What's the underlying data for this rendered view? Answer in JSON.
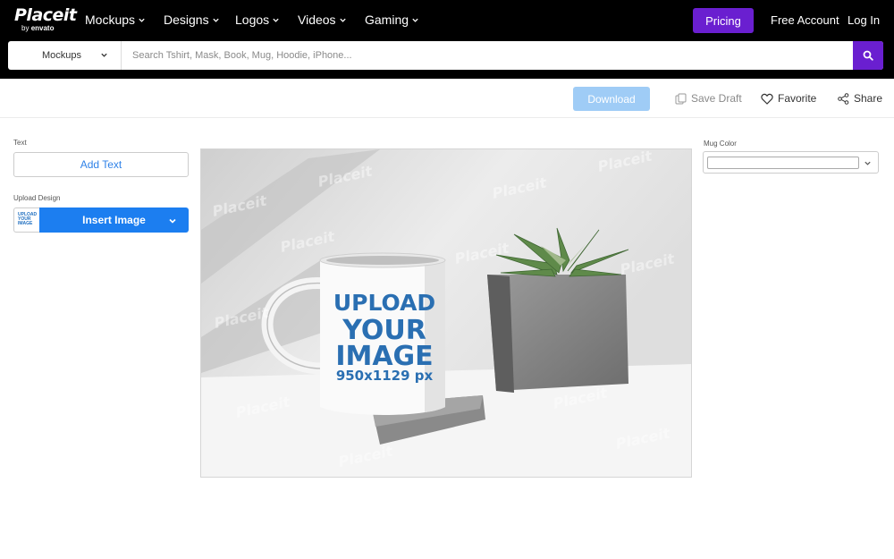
{
  "brand": {
    "name": "Placeit",
    "by": "by",
    "parent": "envato"
  },
  "nav": {
    "items": [
      {
        "label": "Mockups"
      },
      {
        "label": "Designs"
      },
      {
        "label": "Logos"
      },
      {
        "label": "Videos"
      },
      {
        "label": "Gaming"
      }
    ],
    "pricing": "Pricing",
    "free_account": "Free Account",
    "login": "Log In"
  },
  "search": {
    "category": "Mockups",
    "placeholder": "Search Tshirt, Mask, Book, Mug, Hoodie, iPhone...",
    "value": ""
  },
  "toolbar": {
    "download": "Download",
    "save_draft": "Save Draft",
    "favorite": "Favorite",
    "share": "Share"
  },
  "left_panel": {
    "text_label": "Text",
    "add_text": "Add Text",
    "upload_label": "Upload Design",
    "thumb_lines": [
      "UPLOAD",
      "YOUR",
      "IMAGE"
    ],
    "insert_image": "Insert Image"
  },
  "canvas": {
    "watermark": "Placeit",
    "mug_text": [
      "UPLOAD",
      "YOUR",
      "IMAGE"
    ],
    "mug_size": "950x1129 px"
  },
  "right_panel": {
    "mug_color_label": "Mug Color",
    "mug_color_value": "#ffffff"
  },
  "colors": {
    "accent_purple": "#6a1fd0",
    "primary_blue": "#1c7ef0",
    "download_disabled": "#9fccf6",
    "mug_print_blue": "#2a6fb2"
  }
}
